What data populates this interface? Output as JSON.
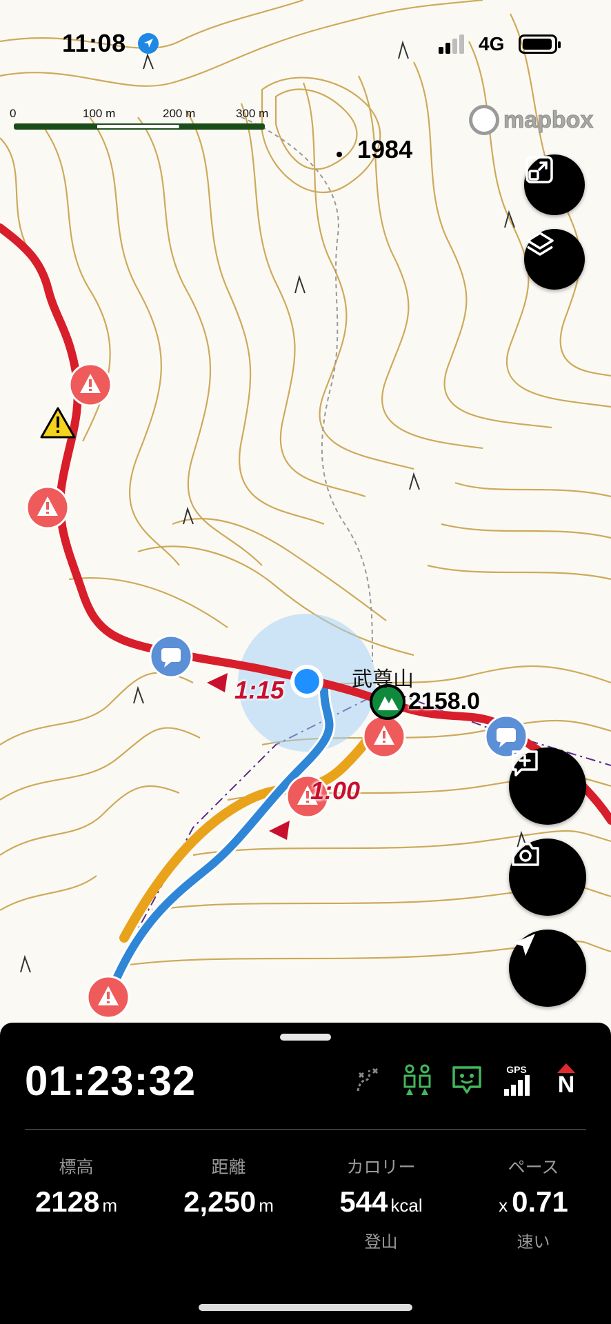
{
  "status_bar": {
    "time": "11:08",
    "network": "4G",
    "location_icon": "location-arrow-icon",
    "signal_icon": "signal-bars-icon",
    "battery_icon": "battery-icon"
  },
  "map": {
    "scale_labels": [
      "0",
      "100 m",
      "200 m",
      "300 m"
    ],
    "attribution": "mapbox",
    "peak_spot_elevation": "1984",
    "summit_name": "武尊山",
    "summit_elevation": "2158.0",
    "time_markers": [
      "1:15",
      "1:00"
    ],
    "colors": {
      "route_red": "#d81e2a",
      "track_blue": "#2f86d6",
      "alt_route_orange": "#e8a31b",
      "contour": "#c9a24a",
      "location_blue": "#1e90ff",
      "warning_marker": "#ef5b5b",
      "comment_marker": "#5b8fd6",
      "summit_green": "#0f8a3c"
    }
  },
  "map_controls": {
    "fit_icon": "fit-bounds-icon",
    "layers_icon": "layers-icon",
    "add_note_icon": "add-note-icon",
    "camera_icon": "camera-icon",
    "locate_icon": "navigation-arrow-icon"
  },
  "panel": {
    "elapsed_time": "01:23:32",
    "status_icons": [
      "off-route-icon",
      "companion-icon",
      "message-icon",
      "gps-signal-icon",
      "north-compass-icon"
    ],
    "gps_label": "GPS",
    "north_label": "N",
    "stats": [
      {
        "label": "標高",
        "value": "2128",
        "unit": "m",
        "prefix": "",
        "sub": ""
      },
      {
        "label": "距離",
        "value": "2,250",
        "unit": "m",
        "prefix": "",
        "sub": ""
      },
      {
        "label": "カロリー",
        "value": "544",
        "unit": "kcal",
        "prefix": "",
        "sub": "登山"
      },
      {
        "label": "ペース",
        "value": "0.71",
        "unit": "",
        "prefix": "x",
        "sub": "速い"
      }
    ]
  }
}
